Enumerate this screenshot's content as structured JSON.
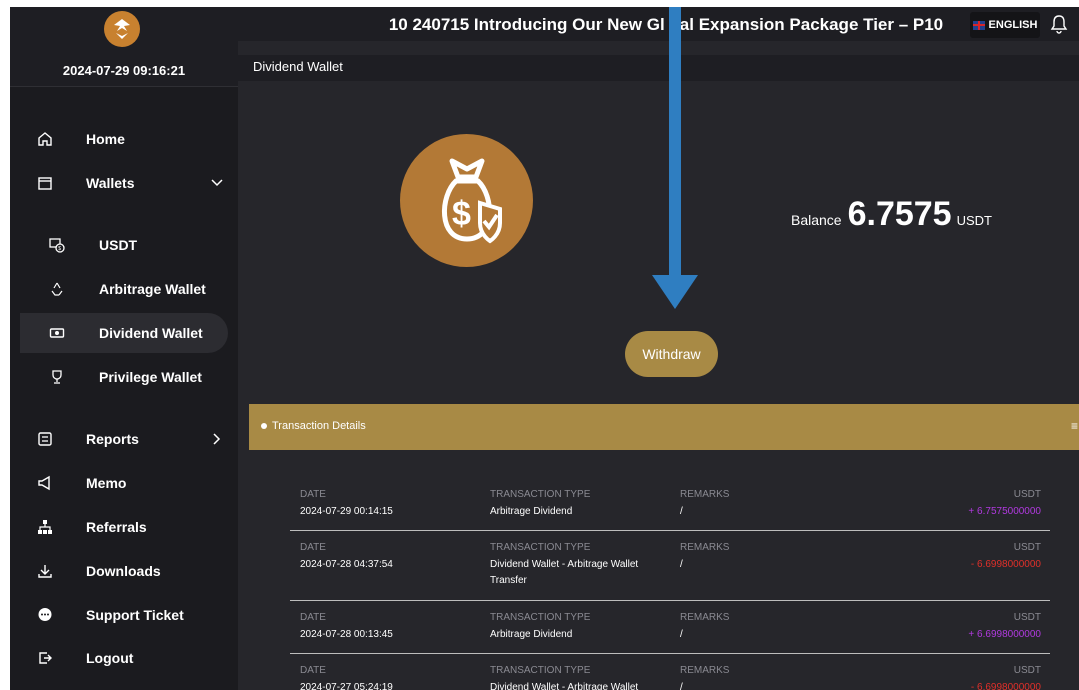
{
  "header": {
    "datetime": "2024-07-29 09:16:21",
    "announcement": "10 240715 Introducing Our New Gl   bal Expansion Package Tier – P10",
    "language": "ENGLISH"
  },
  "breadcrumb": "Dividend Wallet",
  "sidebar": {
    "items": [
      {
        "label": "Home",
        "icon": "home-icon"
      },
      {
        "label": "Wallets",
        "icon": "wallet-icon",
        "expanded": true
      },
      {
        "label": "USDT",
        "icon": "usdt-icon"
      },
      {
        "label": "Arbitrage Wallet",
        "icon": "recycle-icon"
      },
      {
        "label": "Dividend Wallet",
        "icon": "cash-icon",
        "active": true
      },
      {
        "label": "Privilege Wallet",
        "icon": "trophy-icon"
      },
      {
        "label": "Reports",
        "icon": "report-icon"
      },
      {
        "label": "Memo",
        "icon": "megaphone-icon"
      },
      {
        "label": "Referrals",
        "icon": "sitemap-icon"
      },
      {
        "label": "Downloads",
        "icon": "download-icon"
      },
      {
        "label": "Support Ticket",
        "icon": "chat-icon"
      },
      {
        "label": "Logout",
        "icon": "logout-icon"
      }
    ]
  },
  "balance": {
    "label": "Balance",
    "value": "6.7575",
    "unit": "USDT"
  },
  "withdraw_label": "Withdraw",
  "transactions": {
    "title": "Transaction Details",
    "headers": {
      "date": "DATE",
      "type": "TRANSACTION TYPE",
      "remarks": "REMARKS",
      "amount": "USDT"
    },
    "rows": [
      {
        "date": "2024-07-29 00:14:15",
        "type": "Arbitrage Dividend",
        "remarks": "/",
        "amount": "+ 6.7575000000"
      },
      {
        "date": "2024-07-28 04:37:54",
        "type": "Dividend Wallet - Arbitrage Wallet Transfer",
        "remarks": "/",
        "amount": "- 6.6998000000"
      },
      {
        "date": "2024-07-28 00:13:45",
        "type": "Arbitrage Dividend",
        "remarks": "/",
        "amount": "+ 6.6998000000"
      },
      {
        "date": "2024-07-27 05:24:19",
        "type": "Dividend Wallet - Arbitrage Wallet",
        "remarks": "/",
        "amount": "- 6.6998000000"
      }
    ]
  },
  "colors": {
    "gold": "#a88a45",
    "sidebar_bg": "#1b1b1f",
    "main_bg": "#26262b",
    "positive": "#b13ae0",
    "negative": "#e0302a",
    "arrow": "#2f7ec1"
  }
}
